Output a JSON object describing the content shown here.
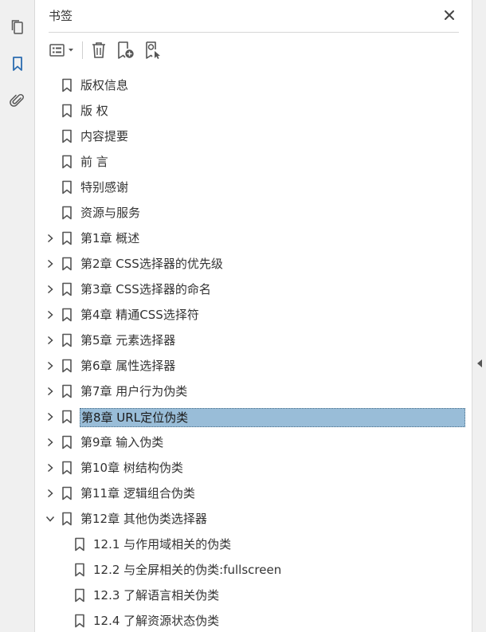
{
  "panel": {
    "title": "书签"
  },
  "rail": {
    "icons": [
      "pages-icon",
      "bookmark-icon",
      "attachment-icon"
    ]
  },
  "toolbar": {
    "icons": [
      "options-menu-icon",
      "delete-icon",
      "new-bookmark-icon",
      "find-bookmark-icon"
    ]
  },
  "bookmarks": [
    {
      "label": "版权信息"
    },
    {
      "label": "版 权"
    },
    {
      "label": "内容提要"
    },
    {
      "label": "前 言"
    },
    {
      "label": "特别感谢"
    },
    {
      "label": "资源与服务"
    },
    {
      "label": "第1章 概述"
    },
    {
      "label": "第2章 CSS选择器的优先级"
    },
    {
      "label": "第3章 CSS选择器的命名"
    },
    {
      "label": "第4章 精通CSS选择符"
    },
    {
      "label": "第5章 元素选择器"
    },
    {
      "label": "第6章 属性选择器"
    },
    {
      "label": "第7章 用户行为伪类"
    },
    {
      "label": "第8章 URL定位伪类"
    },
    {
      "label": "第9章 输入伪类"
    },
    {
      "label": "第10章 树结构伪类"
    },
    {
      "label": "第11章 逻辑组合伪类"
    },
    {
      "label": "第12章 其他伪类选择器"
    },
    {
      "label": "12.1 与作用域相关的伪类"
    },
    {
      "label": "12.2 与全屏相关的伪类:fullscreen"
    },
    {
      "label": "12.3 了解语言相关伪类"
    },
    {
      "label": "12.4 了解资源状态伪类"
    }
  ],
  "colors": {
    "selection": "#99bdd8",
    "rail": "#f0f0f0",
    "accent": "#2b6cb0"
  }
}
